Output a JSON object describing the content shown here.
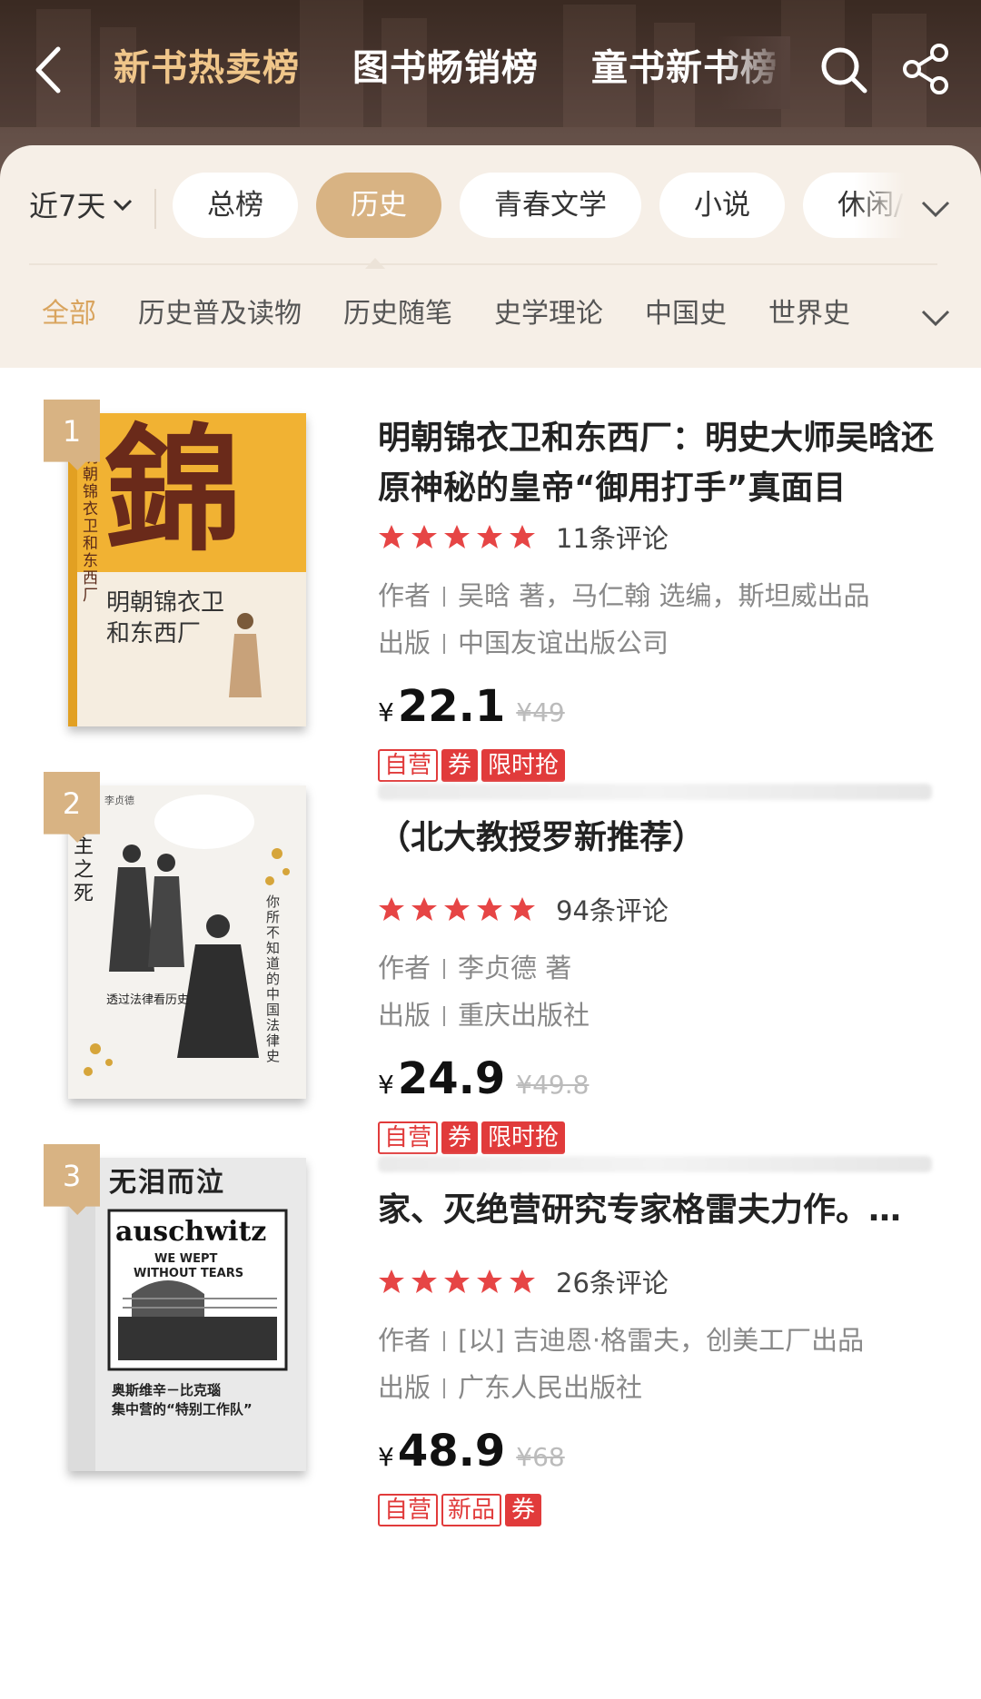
{
  "header": {
    "tabs": [
      {
        "label": "新书热卖榜",
        "active": true
      },
      {
        "label": "图书畅销榜",
        "active": false
      },
      {
        "label": "童书新书榜",
        "active": false
      }
    ],
    "accent": "#f0c68a"
  },
  "filters": {
    "period": "近7天",
    "categories": [
      "总榜",
      "历史",
      "青春文学",
      "小说",
      "休闲/"
    ],
    "active_category": "历史",
    "subcategories": [
      "全部",
      "历史普及读物",
      "历史随笔",
      "史学理论",
      "中国史",
      "世界史"
    ],
    "active_subcategory": "全部",
    "accent": "#d8b383"
  },
  "books": [
    {
      "rank": "1",
      "title": "明朝锦衣卫和东西厂：明史大师吴晗还原神秘的皇帝“御用打手”真面目",
      "rating_stars": 5,
      "reviews": "11条评论",
      "author_label": "作者",
      "author": "吴晗 著，马仁翰 选编，斯坦威出品",
      "publisher_label": "出版",
      "publisher": "中国友谊出版公司",
      "currency": "¥",
      "price": "22.1",
      "original_price": "¥49",
      "tags": [
        "自营",
        "券",
        "限时抢"
      ],
      "cover": {
        "big_char": "錦",
        "title_line1": "明朝锦衣卫",
        "title_line2": "和东西厂",
        "spine": "明朝锦衣卫和东西厂",
        "bg": "#f1b233"
      }
    },
    {
      "rank": "2",
      "title": "（北大教授罗新推荐）",
      "rating_stars": 5,
      "reviews": "94条评论",
      "author_label": "作者",
      "author": "李贞德 著",
      "publisher_label": "出版",
      "publisher": "重庆出版社",
      "currency": "¥",
      "price": "24.9",
      "original_price": "¥49.8",
      "tags": [
        "自营",
        "券",
        "限时抢"
      ],
      "cover": {
        "author": "李贞德",
        "spine": "主之死",
        "vertical": "你所不知道的中国法律史",
        "subtitle": "透过法律看历史",
        "bg": "#f4f2ee"
      }
    },
    {
      "rank": "3",
      "title": "家、灭绝营研究专家格雷夫力作。…",
      "rating_stars": 5,
      "reviews": "26条评论",
      "author_label": "作者",
      "author": "[以] 吉迪恩·格雷夫，创美工厂出品",
      "publisher_label": "出版",
      "publisher": "广东人民出版社",
      "currency": "¥",
      "price": "48.9",
      "original_price": "¥68",
      "tags": [
        "自营",
        "新品",
        "券"
      ],
      "cover": {
        "top_title": "无泪而泣",
        "brand": "auschwitz",
        "en_line1": "WE WEPT",
        "en_line2": "WITHOUT TEARS",
        "cn1": "奥斯维辛－比克瑙",
        "cn2": "集中营的“特别工作队”",
        "bg": "#e9e9e9"
      }
    }
  ],
  "colors": {
    "star": "#e64545",
    "tag": "#e13b3b",
    "price": "#111111"
  }
}
